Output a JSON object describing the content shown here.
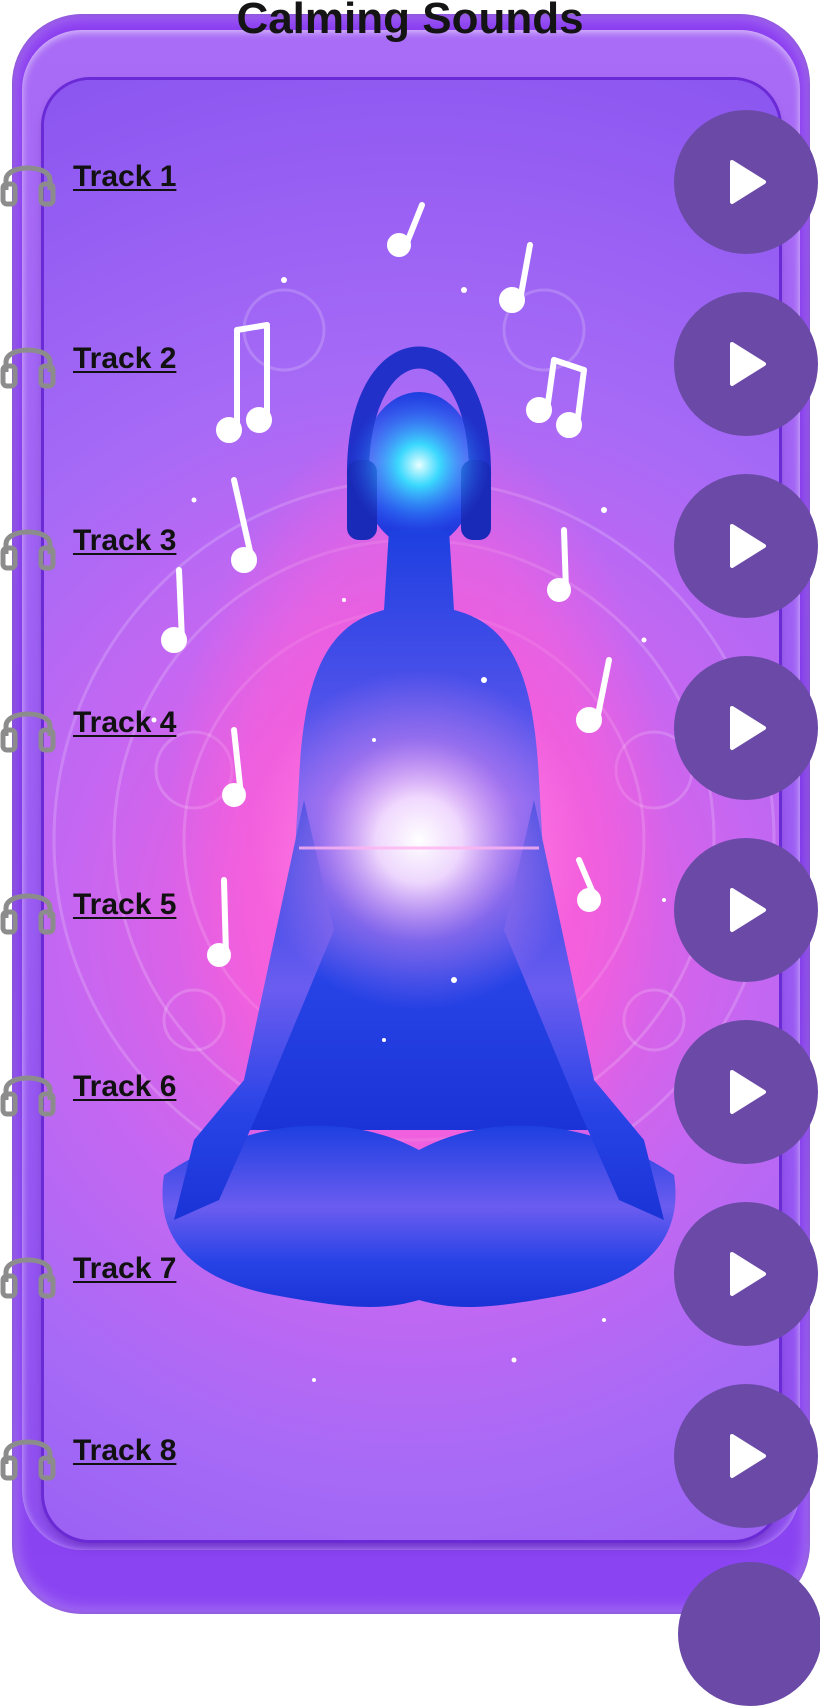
{
  "app": {
    "title": "Calming Sounds"
  },
  "colors": {
    "frame": "#8a3cf0",
    "play_button": "#6a4aa6",
    "icon": "#8c8c8c",
    "text": "#111111"
  },
  "icons": {
    "track": "headphones-icon",
    "action": "play-icon"
  },
  "tracks": [
    {
      "label": "Track 1"
    },
    {
      "label": "Track 2"
    },
    {
      "label": "Track 3"
    },
    {
      "label": "Track 4"
    },
    {
      "label": "Track 5"
    },
    {
      "label": "Track 6"
    },
    {
      "label": "Track 7"
    },
    {
      "label": "Track 8"
    }
  ]
}
